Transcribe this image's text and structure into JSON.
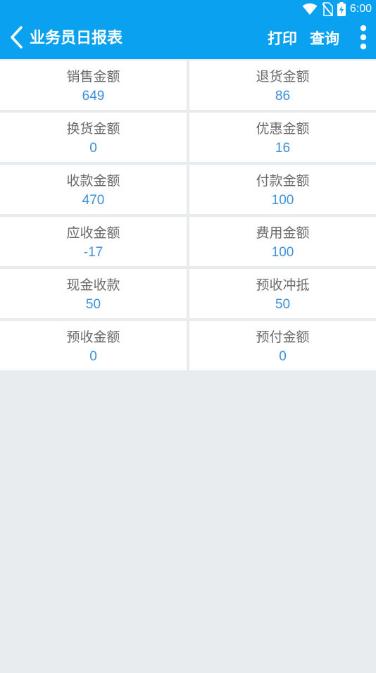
{
  "status_bar": {
    "time": "6:00",
    "icons": [
      "wifi-icon",
      "no-sim-icon",
      "battery-charging-icon"
    ]
  },
  "app_bar": {
    "back_icon": "chevron-left-icon",
    "title": "业务员日报表",
    "actions": {
      "print_label": "打印",
      "query_label": "查询"
    },
    "more_icon": "more-vertical-icon"
  },
  "colors": {
    "primary": "#0aa2f0",
    "value_text": "#3e8fd9",
    "label_text": "#6a6a6a",
    "background": "#e8ecee"
  },
  "summary": {
    "cells": [
      {
        "label": "销售金额",
        "value": "649"
      },
      {
        "label": "退货金额",
        "value": "86"
      },
      {
        "label": "换货金额",
        "value": "0"
      },
      {
        "label": "优惠金额",
        "value": "16"
      },
      {
        "label": "收款金额",
        "value": "470"
      },
      {
        "label": "付款金额",
        "value": "100"
      },
      {
        "label": "应收金额",
        "value": "-17"
      },
      {
        "label": "费用金额",
        "value": "100"
      },
      {
        "label": "现金收款",
        "value": "50"
      },
      {
        "label": "预收冲抵",
        "value": "50"
      },
      {
        "label": "预收金额",
        "value": "0"
      },
      {
        "label": "预付金额",
        "value": "0"
      }
    ]
  }
}
